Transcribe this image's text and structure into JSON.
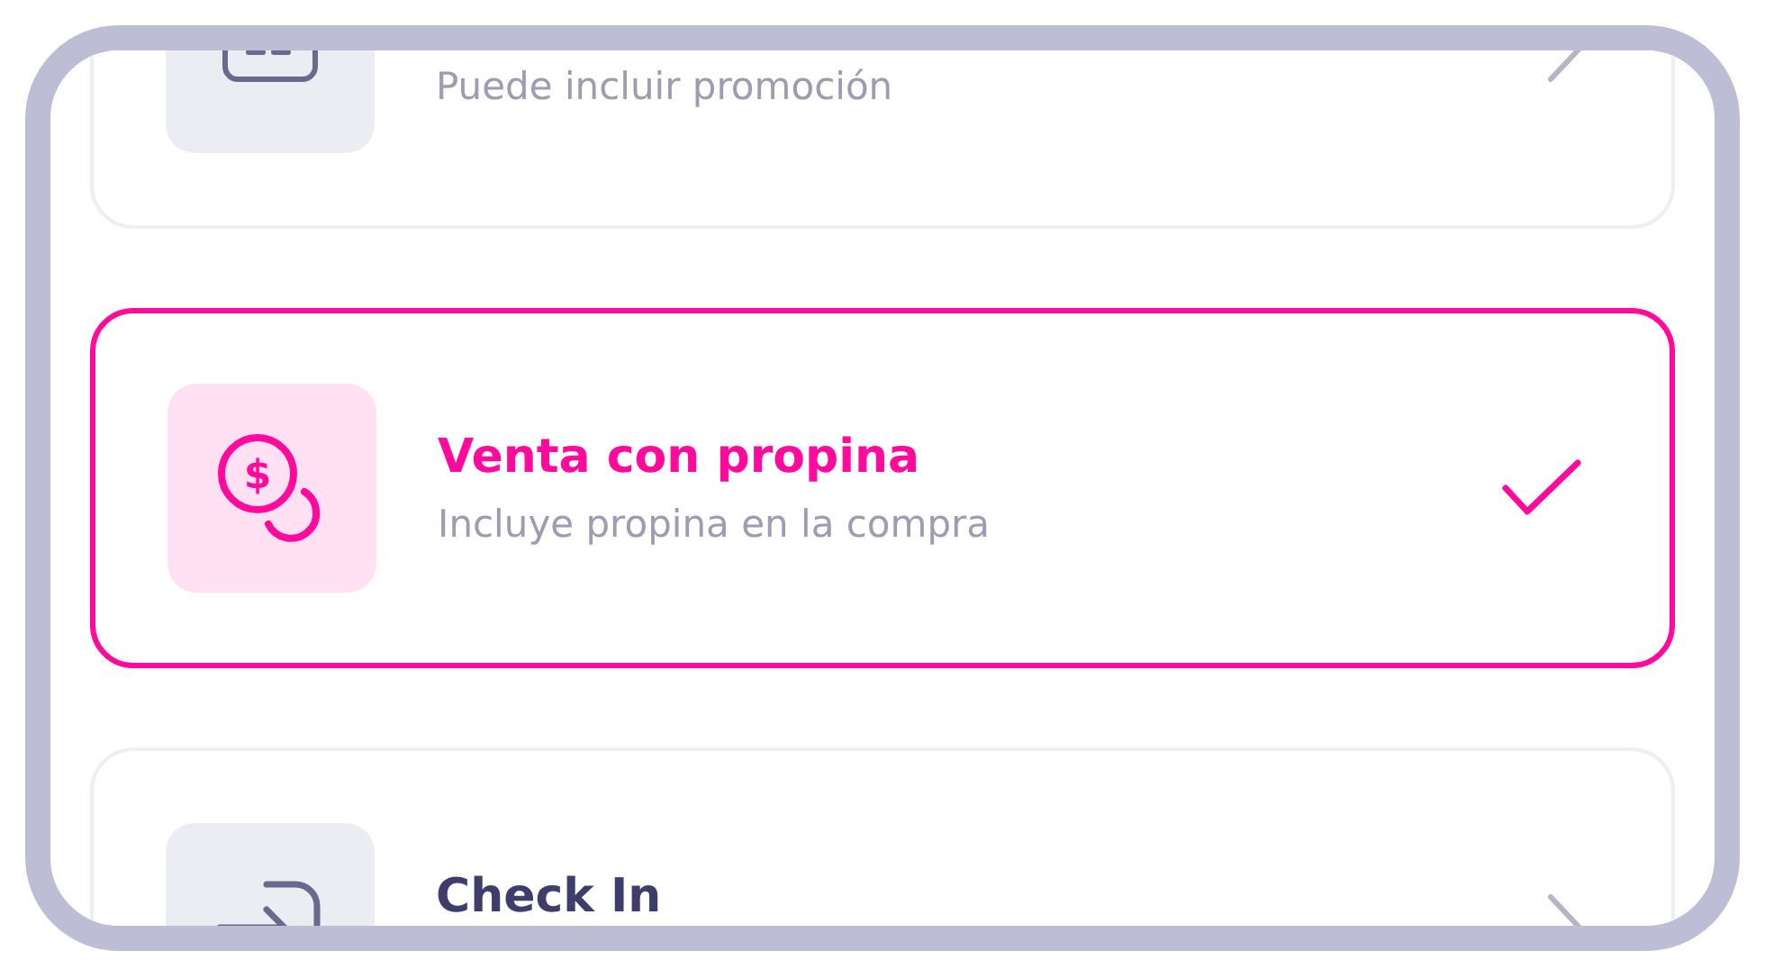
{
  "options": [
    {
      "kind": "ticket",
      "subtitle": "Puede incluir promoción",
      "selected": false
    },
    {
      "kind": "coins",
      "symbol": "$",
      "title": "Venta con propina",
      "subtitle": "Incluye propina en la compra",
      "selected": true
    },
    {
      "kind": "checkin",
      "title": "Check In",
      "selected": false
    }
  ]
}
